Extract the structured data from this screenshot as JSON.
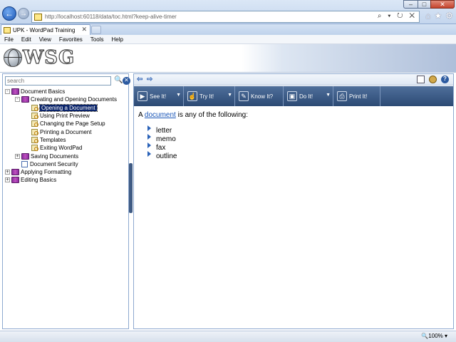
{
  "browser": {
    "address": "http://localhost:60118/data/toc.html?keep-alive-timer",
    "address_tools": "⌕ ▾ ↻ ✕",
    "window_controls": {
      "minimize": "–",
      "maximize": "□",
      "close": "✕"
    },
    "tab_title": "UPK - WordPad Training",
    "tab_close": "✕",
    "menu": [
      "File",
      "Edit",
      "View",
      "Favorites",
      "Tools",
      "Help"
    ],
    "zoom": "🔍100%  ▾"
  },
  "banner": {
    "logo_text": "WSG"
  },
  "outline": {
    "search_placeholder": "search",
    "search_go_icon": "🔍",
    "search_clear_icon": "✕",
    "tree": [
      {
        "label": "Document Basics",
        "exp": "-",
        "icon": "book"
      },
      {
        "label": "Creating and Opening Documents",
        "exp": "-",
        "icon": "book"
      },
      {
        "label": "Opening a Document",
        "icon": "topic",
        "selected": true
      },
      {
        "label": "Using Print Preview",
        "icon": "topic"
      },
      {
        "label": "Changing the Page Setup",
        "icon": "topic"
      },
      {
        "label": "Printing a Document",
        "icon": "topic"
      },
      {
        "label": "Templates",
        "icon": "topic"
      },
      {
        "label": "Exiting WordPad",
        "icon": "topic"
      },
      {
        "label": "Saving Documents",
        "exp": "+",
        "icon": "book"
      },
      {
        "label": "Document Security",
        "icon": "doc"
      },
      {
        "label": "Applying Formatting",
        "exp": "+",
        "icon": "book"
      },
      {
        "label": "Editing Basics",
        "exp": "+",
        "icon": "book"
      }
    ]
  },
  "player": {
    "toolbar": [
      {
        "label": "See It!",
        "icon": "▶",
        "dropdown": true
      },
      {
        "label": "Try It!",
        "icon": "☝",
        "dropdown": true
      },
      {
        "label": "Know It?",
        "icon": "✎",
        "dropdown": false
      },
      {
        "label": "Do It!",
        "icon": "▣",
        "dropdown": true
      },
      {
        "label": "Print It!",
        "icon": "⎙",
        "dropdown": false
      }
    ],
    "content": {
      "intro_prefix": "A ",
      "intro_link": "document",
      "intro_suffix": " is any of the following:",
      "items": [
        "letter",
        "memo",
        "fax",
        "outline"
      ]
    }
  }
}
